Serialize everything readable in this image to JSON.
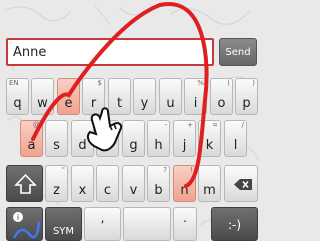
{
  "text_field": {
    "value": "Anne"
  },
  "send_button": {
    "label": "Send"
  },
  "keyboard": {
    "row1": [
      {
        "key": "q",
        "hint": "EN"
      },
      {
        "key": "w",
        "hint": ""
      },
      {
        "key": "e",
        "hint": ""
      },
      {
        "key": "r",
        "hint": "$"
      },
      {
        "key": "t",
        "hint": ""
      },
      {
        "key": "y",
        "hint": ""
      },
      {
        "key": "u",
        "hint": ""
      },
      {
        "key": "i",
        "hint": "%"
      },
      {
        "key": "o",
        "hint": "("
      },
      {
        "key": "p",
        "hint": ")"
      }
    ],
    "row2": [
      {
        "key": "a",
        "hint": "@"
      },
      {
        "key": "s",
        "hint": ""
      },
      {
        "key": "d",
        "hint": ""
      },
      {
        "key": "f",
        "hint": "*"
      },
      {
        "key": "g",
        "hint": ""
      },
      {
        "key": "h",
        "hint": "-"
      },
      {
        "key": "j",
        "hint": "+"
      },
      {
        "key": "k",
        "hint": "="
      },
      {
        "key": "l",
        "hint": "/"
      }
    ],
    "row3": [
      {
        "key": "z",
        "hint": "\""
      },
      {
        "key": "x",
        "hint": ""
      },
      {
        "key": "c",
        "hint": ""
      },
      {
        "key": "v",
        "hint": ""
      },
      {
        "key": "b",
        "hint": "?"
      },
      {
        "key": "n",
        "hint": "!"
      },
      {
        "key": "m",
        "hint": ""
      }
    ],
    "bottom": {
      "sym_label": "SYM",
      "comma_label": ",",
      "period_label": ".",
      "smiley_label": ":-)"
    },
    "pressed_keys": [
      "e",
      "a",
      "n"
    ],
    "shift_icon": "shift-arrow-icon",
    "backspace_icon": "backspace-icon",
    "swype_icon": "swype-info-icon",
    "gesture_icon": "hand-pointer-icon",
    "trace_color": "#e02020"
  }
}
